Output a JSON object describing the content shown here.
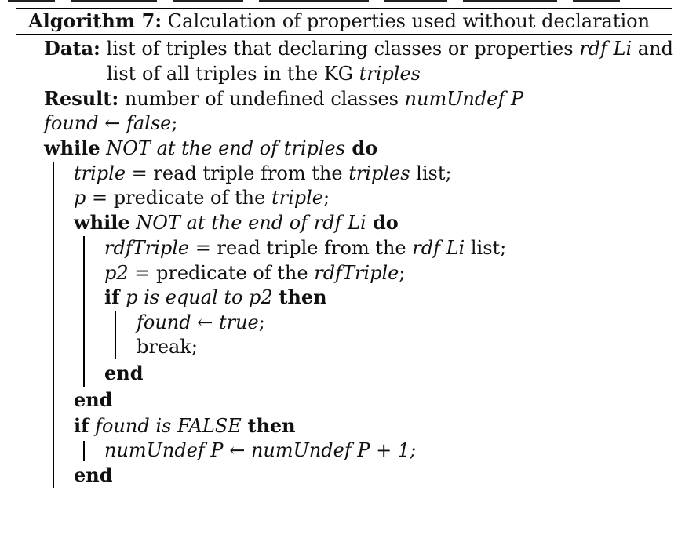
{
  "algorithm": {
    "caption_label": "Algorithm 7:",
    "caption_text": " Calculation of properties used without declaration",
    "data": {
      "keyword": "Data:",
      "line1_text": " list of triples that declaring classes or properties ",
      "line1_var": "rdf Li",
      "line1_end": " and",
      "line2_text": "list of all triples in the KG ",
      "line2_var": "triples"
    },
    "result": {
      "keyword": "Result:",
      "text": " number of undefined classes ",
      "var": "numUndef P"
    },
    "init": {
      "var": "found",
      "arrow": " ← ",
      "value": "false",
      "end": ";"
    },
    "outer_while": {
      "keyword": "while",
      "cond": " NOT at the end of ",
      "cond_var": "triples",
      "do": " do",
      "assign_triple": {
        "var": "triple",
        "eq": " = ",
        "text": "read triple from the ",
        "var2": "triples",
        "end": " list;"
      },
      "assign_p": {
        "var": "p",
        "eq": " = ",
        "text": "predicate of the ",
        "var2": "triple",
        "end": ";"
      },
      "inner_while": {
        "keyword": "while",
        "cond": " NOT at the end of ",
        "cond_var": "rdf Li",
        "do": " do",
        "assign_rdf": {
          "var": "rdfTriple",
          "eq": " = ",
          "text": "read triple from the ",
          "var2": "rdf Li",
          "end": " list;"
        },
        "assign_p2": {
          "var": "p2",
          "eq": " = ",
          "text": "predicate of the ",
          "var2": "rdfTriple",
          "end": ";"
        },
        "if": {
          "keyword": "if",
          "cond": " p is equal to p2 ",
          "then": "then",
          "set_found": {
            "var": "found",
            "arrow": " ← ",
            "value": "true",
            "end": ";"
          },
          "break": "break;",
          "end": "end"
        },
        "end": "end"
      },
      "if_found": {
        "keyword": "if",
        "cond": " found is FALSE ",
        "then": "then",
        "stmt": "numUndef P ← numUndef P + 1;",
        "end": "end"
      }
    }
  }
}
